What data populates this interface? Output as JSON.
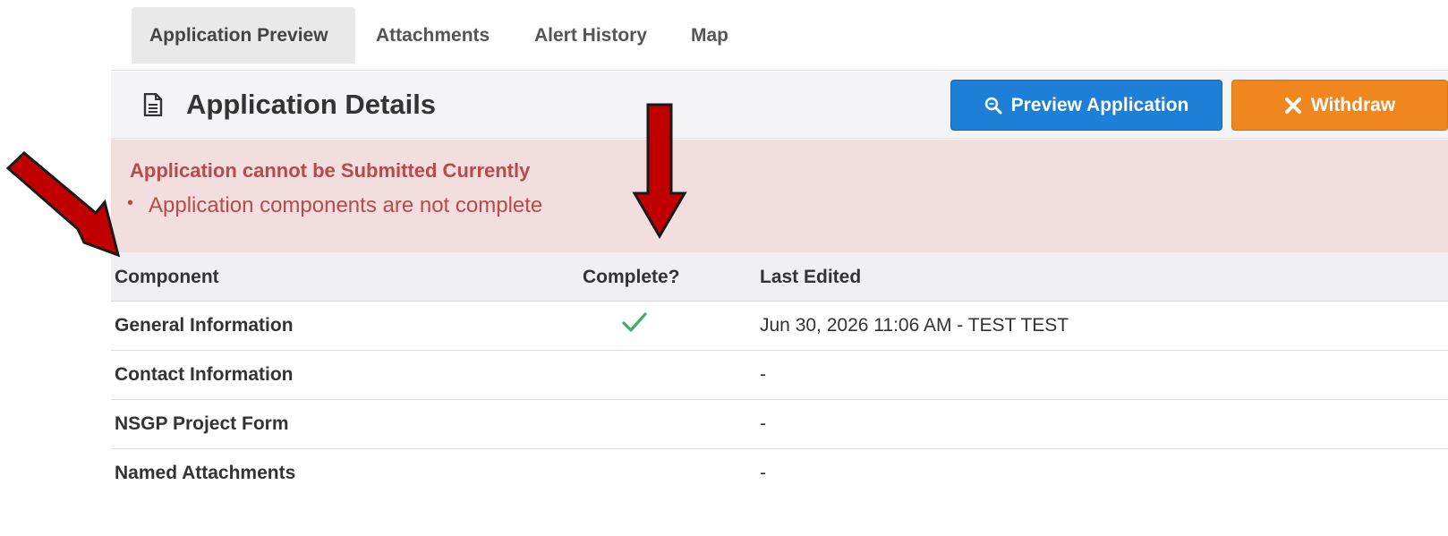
{
  "tabs": [
    {
      "label": "Application Preview",
      "active": true
    },
    {
      "label": "Attachments",
      "active": false
    },
    {
      "label": "Alert History",
      "active": false
    },
    {
      "label": "Map",
      "active": false
    }
  ],
  "header": {
    "title": "Application Details",
    "icon": "document-icon",
    "preview_button": {
      "label": "Preview Application",
      "icon": "search-icon"
    },
    "withdraw_button": {
      "label": "Withdraw",
      "icon": "close-icon"
    }
  },
  "alert": {
    "title": "Application cannot be Submitted Currently",
    "items": [
      "Application components are not complete"
    ]
  },
  "table": {
    "columns": {
      "component": "Component",
      "complete": "Complete?",
      "last_edited": "Last Edited"
    },
    "rows": [
      {
        "component": "General Information",
        "complete": true,
        "last_edited": "Jun 30, 2026 11:06 AM - TEST TEST"
      },
      {
        "component": "Contact Information",
        "complete": false,
        "last_edited": "-"
      },
      {
        "component": "NSGP Project Form",
        "complete": false,
        "last_edited": "-"
      },
      {
        "component": "Named Attachments",
        "complete": false,
        "last_edited": "-"
      }
    ]
  },
  "colors": {
    "primary": "#1e7fd6",
    "warning": "#f0871e",
    "alert_bg": "#f2dede",
    "alert_text": "#b94a48",
    "check": "#3fae6a",
    "annotation_arrow": "#c00000"
  }
}
